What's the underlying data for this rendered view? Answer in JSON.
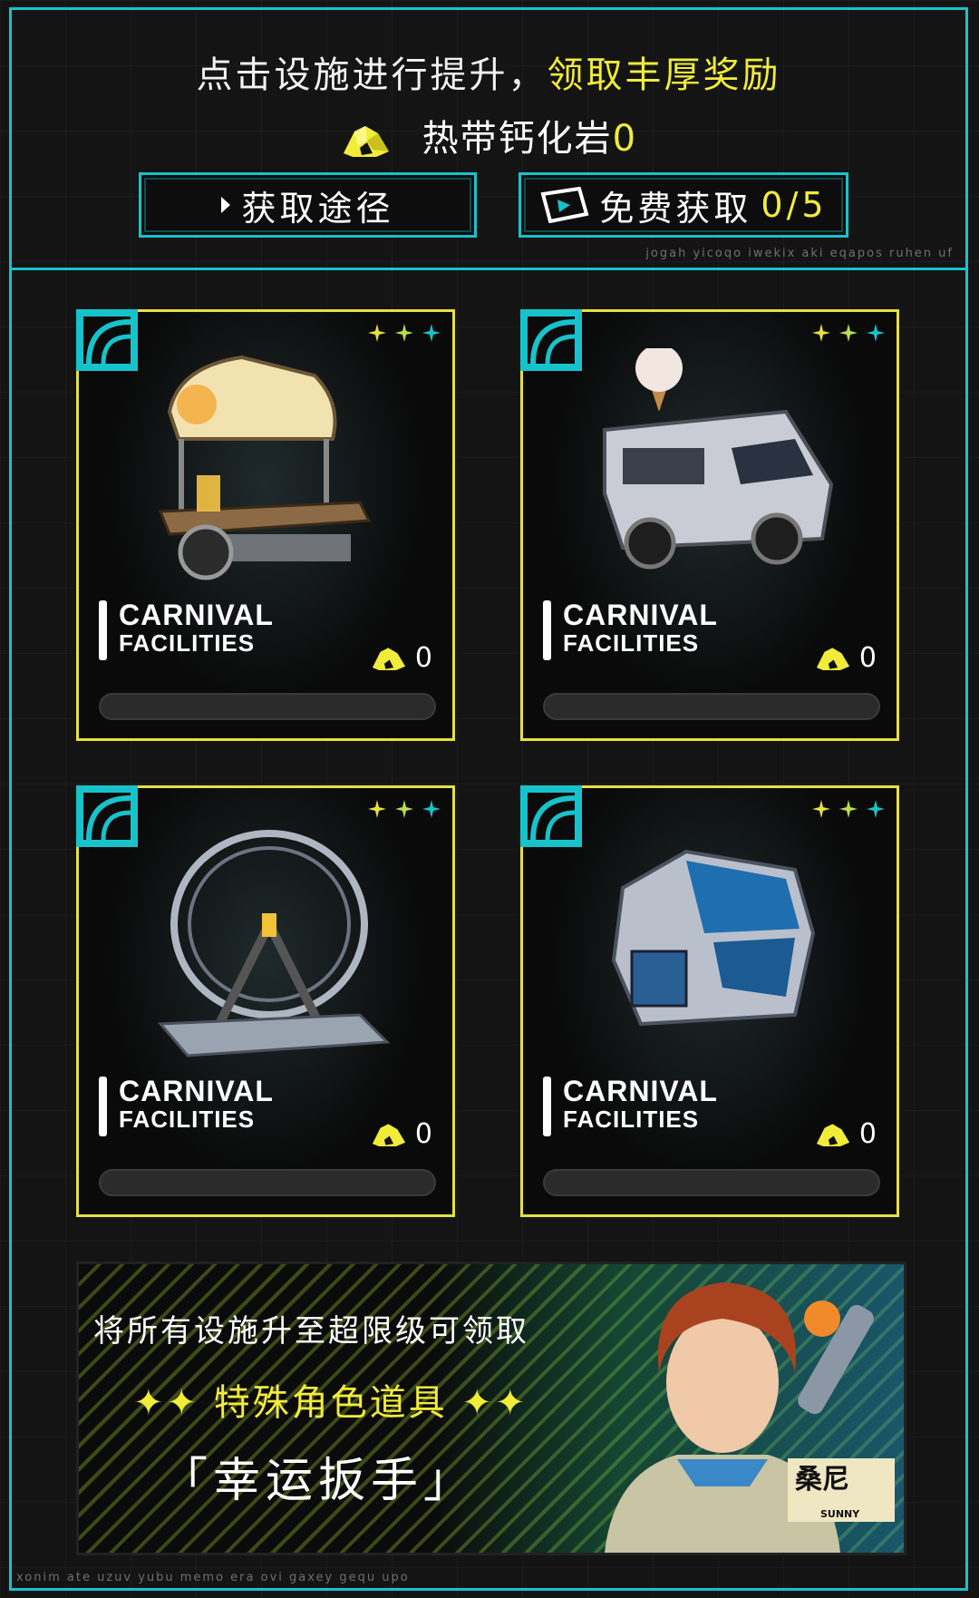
{
  "header": {
    "hint_prefix": "点击设施进行提升，",
    "hint_highlight": "领取丰厚奖励",
    "currency_name": "热带钙化岩",
    "currency_value": "0",
    "route_button_label": "获取途径",
    "free_button_label": "免费获取",
    "free_count": "0/5",
    "tiny_text_top": "jogah yicoqo iwekix aki eqapos ruhen uf"
  },
  "colors": {
    "accent_cyan": "#17c3cb",
    "accent_yellow": "#f1ec39",
    "card_border": "#e6e043"
  },
  "facilities": [
    {
      "title": "CARNIVAL",
      "subtitle": "FACILITIES",
      "cost": "0",
      "icon": "lemonade-cart-icon",
      "progress": 0
    },
    {
      "title": "CARNIVAL",
      "subtitle": "FACILITIES",
      "cost": "0",
      "icon": "ice-cream-truck-icon",
      "progress": 0
    },
    {
      "title": "CARNIVAL",
      "subtitle": "FACILITIES",
      "cost": "0",
      "icon": "ferris-wheel-icon",
      "progress": 0
    },
    {
      "title": "CARNIVAL",
      "subtitle": "FACILITIES",
      "cost": "0",
      "icon": "aquarium-dome-icon",
      "progress": 0
    }
  ],
  "banner": {
    "line1": "将所有设施升至超限级可领取",
    "line2": "特殊角色道具",
    "line3": "「幸运扳手」",
    "character_name": "桑尼",
    "character_name_en": "SUNNY"
  },
  "footer": {
    "tiny_text_bottom": "xonim ate uzuv yubu memo era ovi gaxey gequ upo"
  }
}
